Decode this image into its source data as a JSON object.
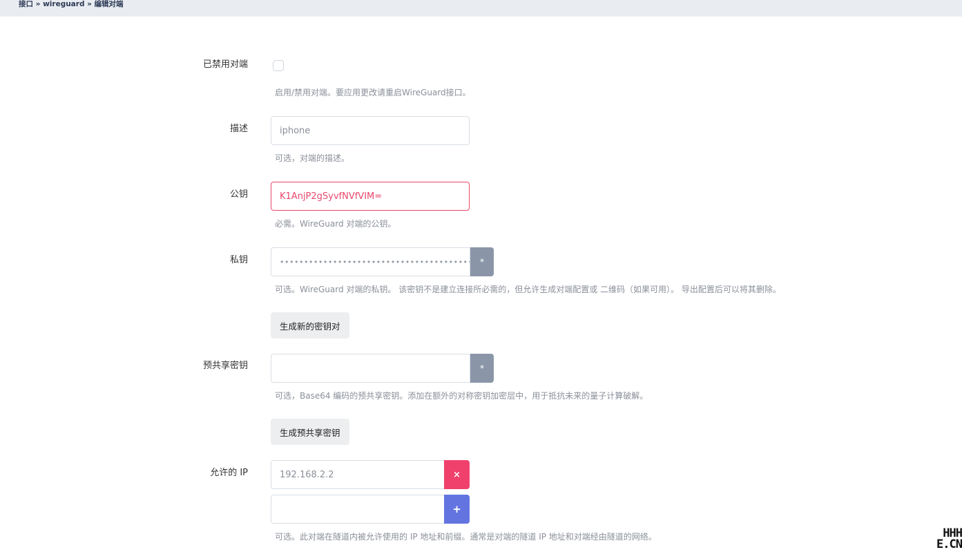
{
  "breadcrumb": "接口 » wireguard » 编辑对端",
  "fields": {
    "disabled": {
      "label": "已禁用对端",
      "checked": false,
      "hint": "启用/禁用对端。要应用更改请重启WireGuard接口。"
    },
    "description": {
      "label": "描述",
      "value": "iphone",
      "hint": "可选，对端的描述。"
    },
    "public_key": {
      "label": "公钥",
      "value": "K1AnjP2gSyvfNVfVIM=",
      "hint": "必需。WireGuard 对端的公钥。"
    },
    "private_key": {
      "label": "私钥",
      "value": "••••••••••••••••••••••••••••••••••••••••••••",
      "toggle_icon": "*",
      "hint": "可选。WireGuard 对端的私钥。 该密钥不是建立连接所必需的，但允许生成对端配置或 二维码（如果可用）。 导出配置后可以将其删除。",
      "generate_button": "生成新的密钥对"
    },
    "preshared_key": {
      "label": "预共享密钥",
      "value": "",
      "toggle_icon": "*",
      "hint": "可选，Base64 编码的预共享密钥。添加在额外的对称密钥加密层中，用于抵抗未来的量子计算破解。",
      "generate_button": "生成预共享密钥"
    },
    "allowed_ips": {
      "label": "允许的 IP",
      "entries": [
        "192.168.2.2"
      ],
      "new_entry": "",
      "remove_icon": "×",
      "add_icon": "+",
      "hint": "可选。此对端在隧道内被允许使用的 IP 地址和前缀。通常是对端的隧道 IP 地址和对端经由隧道的网络。"
    }
  },
  "logo": {
    "line1": "HHH",
    "line2": "E.CN"
  },
  "colors": {
    "invalid": "#e8486b",
    "remove": "#f0416c",
    "add": "#6374e0",
    "toggle": "#8a96a8"
  }
}
